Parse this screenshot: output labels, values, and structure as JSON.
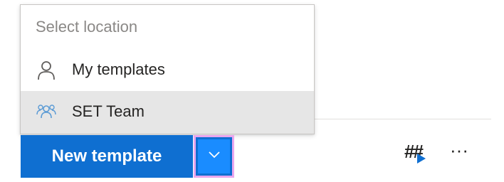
{
  "dropdown": {
    "header": "Select location",
    "items": [
      {
        "label": "My templates",
        "icon": "person-icon"
      },
      {
        "label": "SET Team",
        "icon": "people-group-icon"
      }
    ]
  },
  "toolbar": {
    "new_template_label": "New template",
    "split_icon": "chevron-down-icon",
    "hash_text": "##",
    "more_text": "···"
  },
  "colors": {
    "primary": "#0f6fd1",
    "primary_pressed": "#1a8cff",
    "focus_outline": "#e9a6ee",
    "hover_row": "#e6e6e6",
    "icon_blue": "#5b9bd5"
  }
}
